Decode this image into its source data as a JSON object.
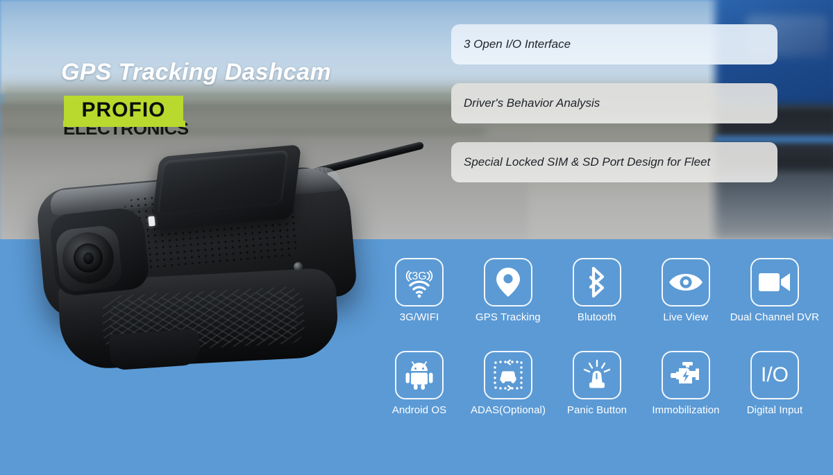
{
  "banner": {
    "headline": "GPS Tracking Dashcam",
    "background_blue": "#5b9ad5",
    "logo": {
      "name": "PROFIO",
      "subtitle": "ELECTRONICS",
      "plate_color": "#b9d92e",
      "text_color": "#0d0f0c"
    },
    "product": {
      "name": "gps-tracking-dashcam-device"
    }
  },
  "features": [
    {
      "label": "3 Open I/O Interface"
    },
    {
      "label": "Driver's Behavior Analysis"
    },
    {
      "label": "Special Locked SIM & SD Port Design for Fleet"
    }
  ],
  "icons": {
    "row1": [
      {
        "label": "3G/WIFI",
        "icon": "3g-wifi-icon"
      },
      {
        "label": "GPS Tracking",
        "icon": "map-pin-icon"
      },
      {
        "label": "Blutooth",
        "icon": "bluetooth-icon"
      },
      {
        "label": "Live View",
        "icon": "eye-icon"
      },
      {
        "label": "Dual Channel DVR",
        "icon": "video-camera-icon"
      }
    ],
    "row2": [
      {
        "label": "Android OS",
        "icon": "android-robot-icon"
      },
      {
        "label": "ADAS(Optional)",
        "icon": "adas-car-icon"
      },
      {
        "label": "Panic Button",
        "icon": "siren-beacon-icon"
      },
      {
        "label": "Immobilization",
        "icon": "engine-bolt-icon"
      },
      {
        "label": "Digital Input",
        "icon": "io-text-icon",
        "text": "I/O"
      }
    ]
  }
}
